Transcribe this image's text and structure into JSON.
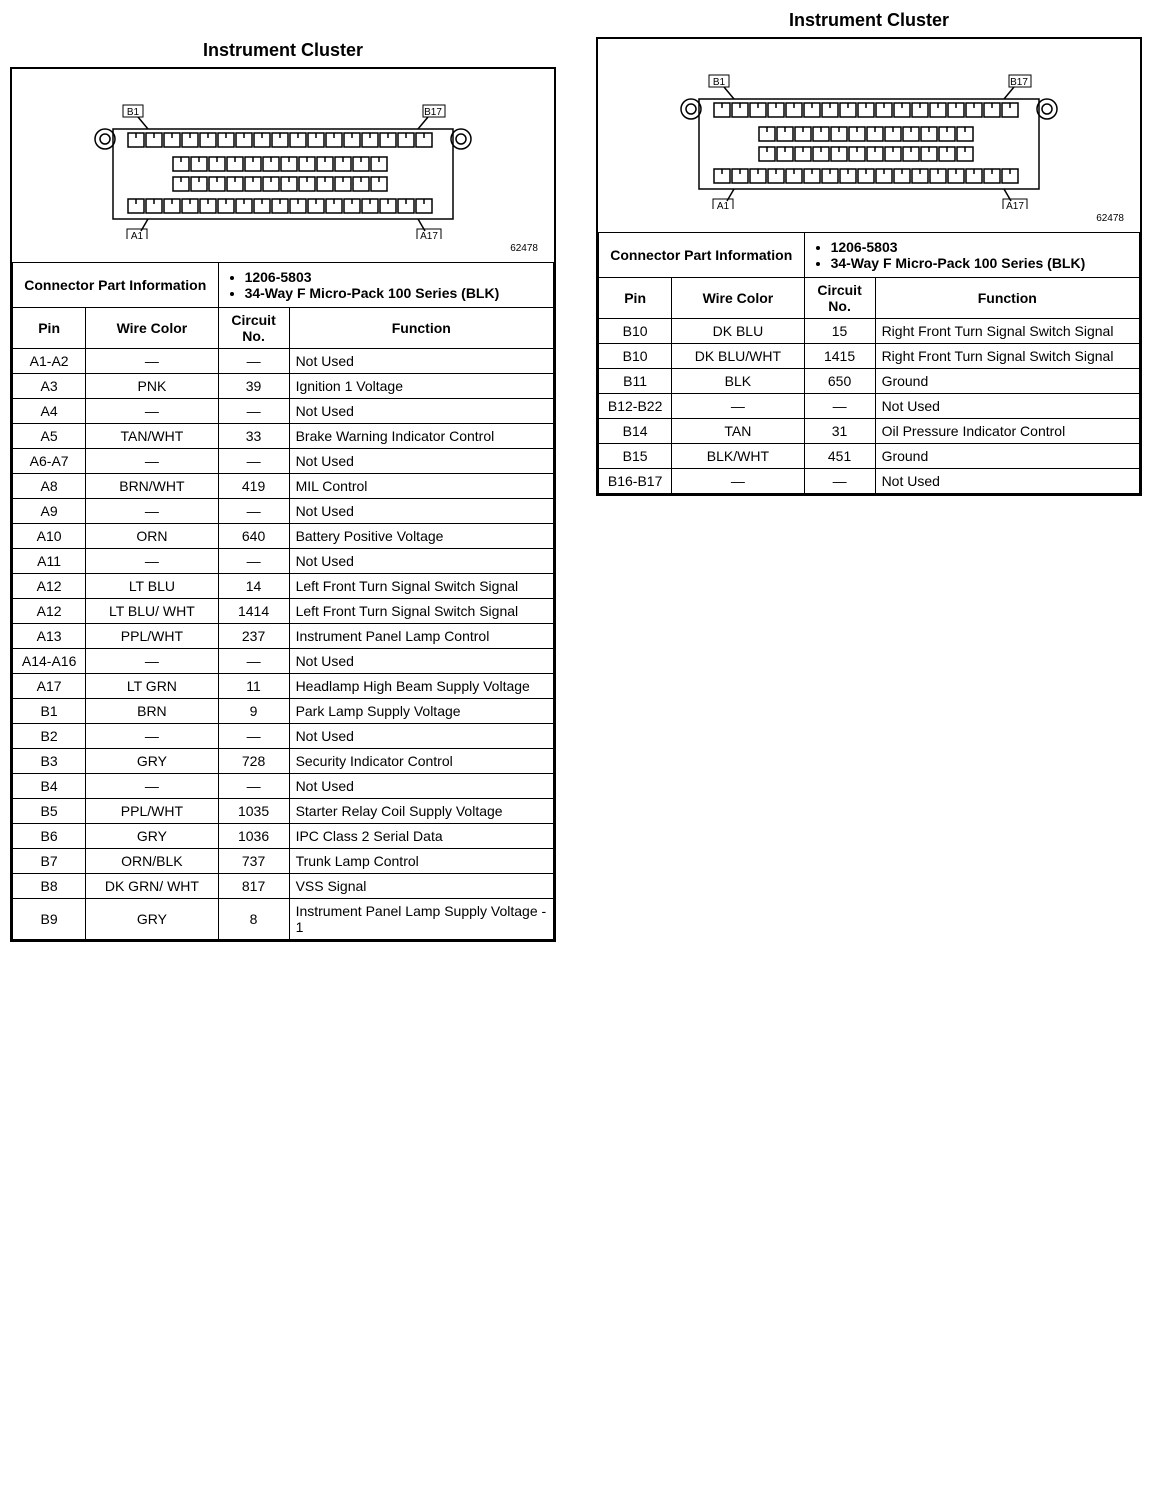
{
  "title": "Instrument Cluster",
  "connector_label": "Connector Part Information",
  "connector_info": [
    "1206-5803",
    "34-Way F Micro-Pack 100 Series (BLK)"
  ],
  "headers": {
    "pin": "Pin",
    "wire": "Wire Color",
    "circuit": "Circuit No.",
    "func": "Function"
  },
  "diag_num": "62478",
  "labels": {
    "b1": "B1",
    "b17": "B17",
    "a1": "A1",
    "a17": "A17"
  },
  "rows_left": [
    {
      "pin": "A1-A2",
      "wire": "—",
      "circuit": "—",
      "func": "Not Used"
    },
    {
      "pin": "A3",
      "wire": "PNK",
      "circuit": "39",
      "func": "Ignition 1 Voltage"
    },
    {
      "pin": "A4",
      "wire": "—",
      "circuit": "—",
      "func": "Not Used"
    },
    {
      "pin": "A5",
      "wire": "TAN/WHT",
      "circuit": "33",
      "func": "Brake Warning Indicator Control"
    },
    {
      "pin": "A6-A7",
      "wire": "—",
      "circuit": "—",
      "func": "Not Used"
    },
    {
      "pin": "A8",
      "wire": "BRN/WHT",
      "circuit": "419",
      "func": "MIL Control"
    },
    {
      "pin": "A9",
      "wire": "—",
      "circuit": "—",
      "func": "Not Used"
    },
    {
      "pin": "A10",
      "wire": "ORN",
      "circuit": "640",
      "func": "Battery Positive Voltage"
    },
    {
      "pin": "A11",
      "wire": "—",
      "circuit": "—",
      "func": "Not Used"
    },
    {
      "pin": "A12",
      "wire": "LT BLU",
      "circuit": "14",
      "func": "Left Front Turn Signal Switch Signal"
    },
    {
      "pin": "A12",
      "wire": "LT BLU/ WHT",
      "circuit": "1414",
      "func": "Left Front Turn Signal Switch Signal"
    },
    {
      "pin": "A13",
      "wire": "PPL/WHT",
      "circuit": "237",
      "func": "Instrument Panel Lamp Control"
    },
    {
      "pin": "A14-A16",
      "wire": "—",
      "circuit": "—",
      "func": "Not Used"
    },
    {
      "pin": "A17",
      "wire": "LT GRN",
      "circuit": "11",
      "func": "Headlamp High Beam Supply Voltage"
    },
    {
      "pin": "B1",
      "wire": "BRN",
      "circuit": "9",
      "func": "Park Lamp Supply Voltage"
    },
    {
      "pin": "B2",
      "wire": "—",
      "circuit": "—",
      "func": "Not Used"
    },
    {
      "pin": "B3",
      "wire": "GRY",
      "circuit": "728",
      "func": "Security Indicator Control"
    },
    {
      "pin": "B4",
      "wire": "—",
      "circuit": "—",
      "func": "Not Used"
    },
    {
      "pin": "B5",
      "wire": "PPL/WHT",
      "circuit": "1035",
      "func": "Starter Relay Coil Supply Voltage"
    },
    {
      "pin": "B6",
      "wire": "GRY",
      "circuit": "1036",
      "func": "IPC Class 2 Serial Data"
    },
    {
      "pin": "B7",
      "wire": "ORN/BLK",
      "circuit": "737",
      "func": "Trunk Lamp Control"
    },
    {
      "pin": "B8",
      "wire": "DK GRN/ WHT",
      "circuit": "817",
      "func": "VSS Signal"
    },
    {
      "pin": "B9",
      "wire": "GRY",
      "circuit": "8",
      "func": "Instrument Panel Lamp Supply Voltage - 1"
    }
  ],
  "rows_right": [
    {
      "pin": "B10",
      "wire": "DK BLU",
      "circuit": "15",
      "func": "Right Front Turn Signal Switch Signal"
    },
    {
      "pin": "B10",
      "wire": "DK BLU/WHT",
      "circuit": "1415",
      "func": "Right Front Turn Signal Switch Signal"
    },
    {
      "pin": "B11",
      "wire": "BLK",
      "circuit": "650",
      "func": "Ground"
    },
    {
      "pin": "B12-B22",
      "wire": "—",
      "circuit": "—",
      "func": "Not Used"
    },
    {
      "pin": "B14",
      "wire": "TAN",
      "circuit": "31",
      "func": "Oil Pressure Indicator Control"
    },
    {
      "pin": "B15",
      "wire": "BLK/WHT",
      "circuit": "451",
      "func": "Ground"
    },
    {
      "pin": "B16-B17",
      "wire": "—",
      "circuit": "—",
      "func": "Not Used"
    }
  ]
}
